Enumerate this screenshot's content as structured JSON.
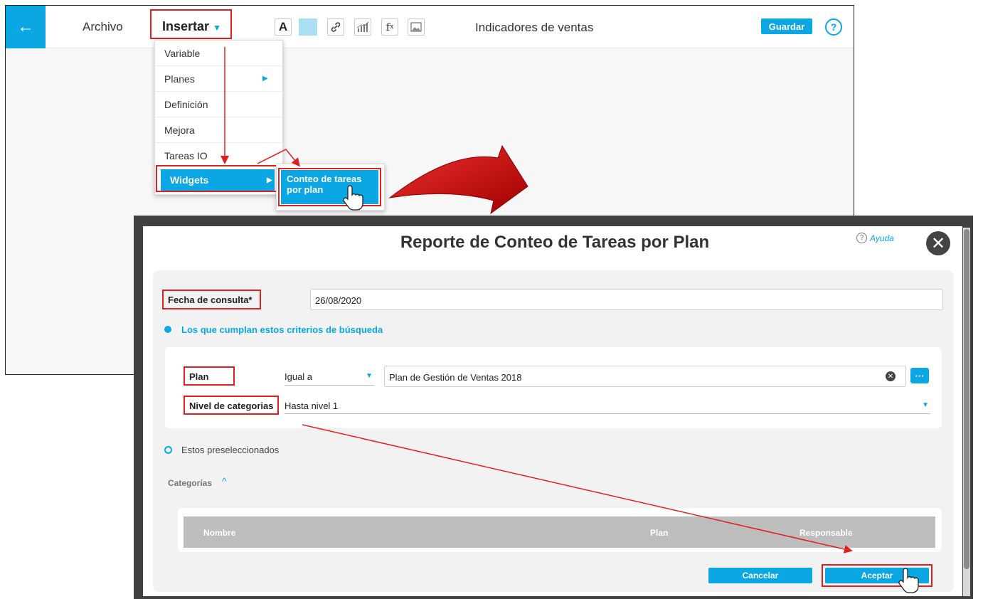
{
  "editor": {
    "menu": {
      "archivo": "Archivo",
      "insertar": "Insertar"
    },
    "toolbar_icons": [
      "text-icon",
      "color-icon",
      "link-icon",
      "chart-icon",
      "formula-icon",
      "image-icon"
    ],
    "document_title": "Indicadores de ventas",
    "save_label": "Guardar",
    "help_symbol": "?",
    "back_symbol": "←"
  },
  "insert_menu": {
    "items": [
      "Variable",
      "Planes",
      "Definición",
      "Mejora",
      "Tareas IO",
      "Widgets"
    ],
    "selected": "Widgets",
    "widgets_submenu": [
      "Conteo de tareas por plan"
    ]
  },
  "dialog": {
    "title": "Reporte de Conteo de Tareas por Plan",
    "help_label": "Ayuda",
    "fecha_label": "Fecha de consulta*",
    "fecha_value": "26/08/2020",
    "option_criteria": "Los que cumplan estos criterios de búsqueda",
    "plan_label": "Plan",
    "plan_operator": "Igual a",
    "plan_value": "Plan de Gestión de Ventas 2018",
    "nivel_label": "Nivel de categorias",
    "nivel_value": "Hasta nivel 1",
    "option_preselected": "Estos preseleccionados",
    "categorias_label": "Categorías",
    "table_columns": [
      "Nombre",
      "Plan",
      "Responsable"
    ],
    "cancel_label": "Cancelar",
    "accept_label": "Aceptar"
  },
  "colors": {
    "accent": "#0aa7e4",
    "highlight": "#e02020",
    "modal_border": "#404040"
  }
}
